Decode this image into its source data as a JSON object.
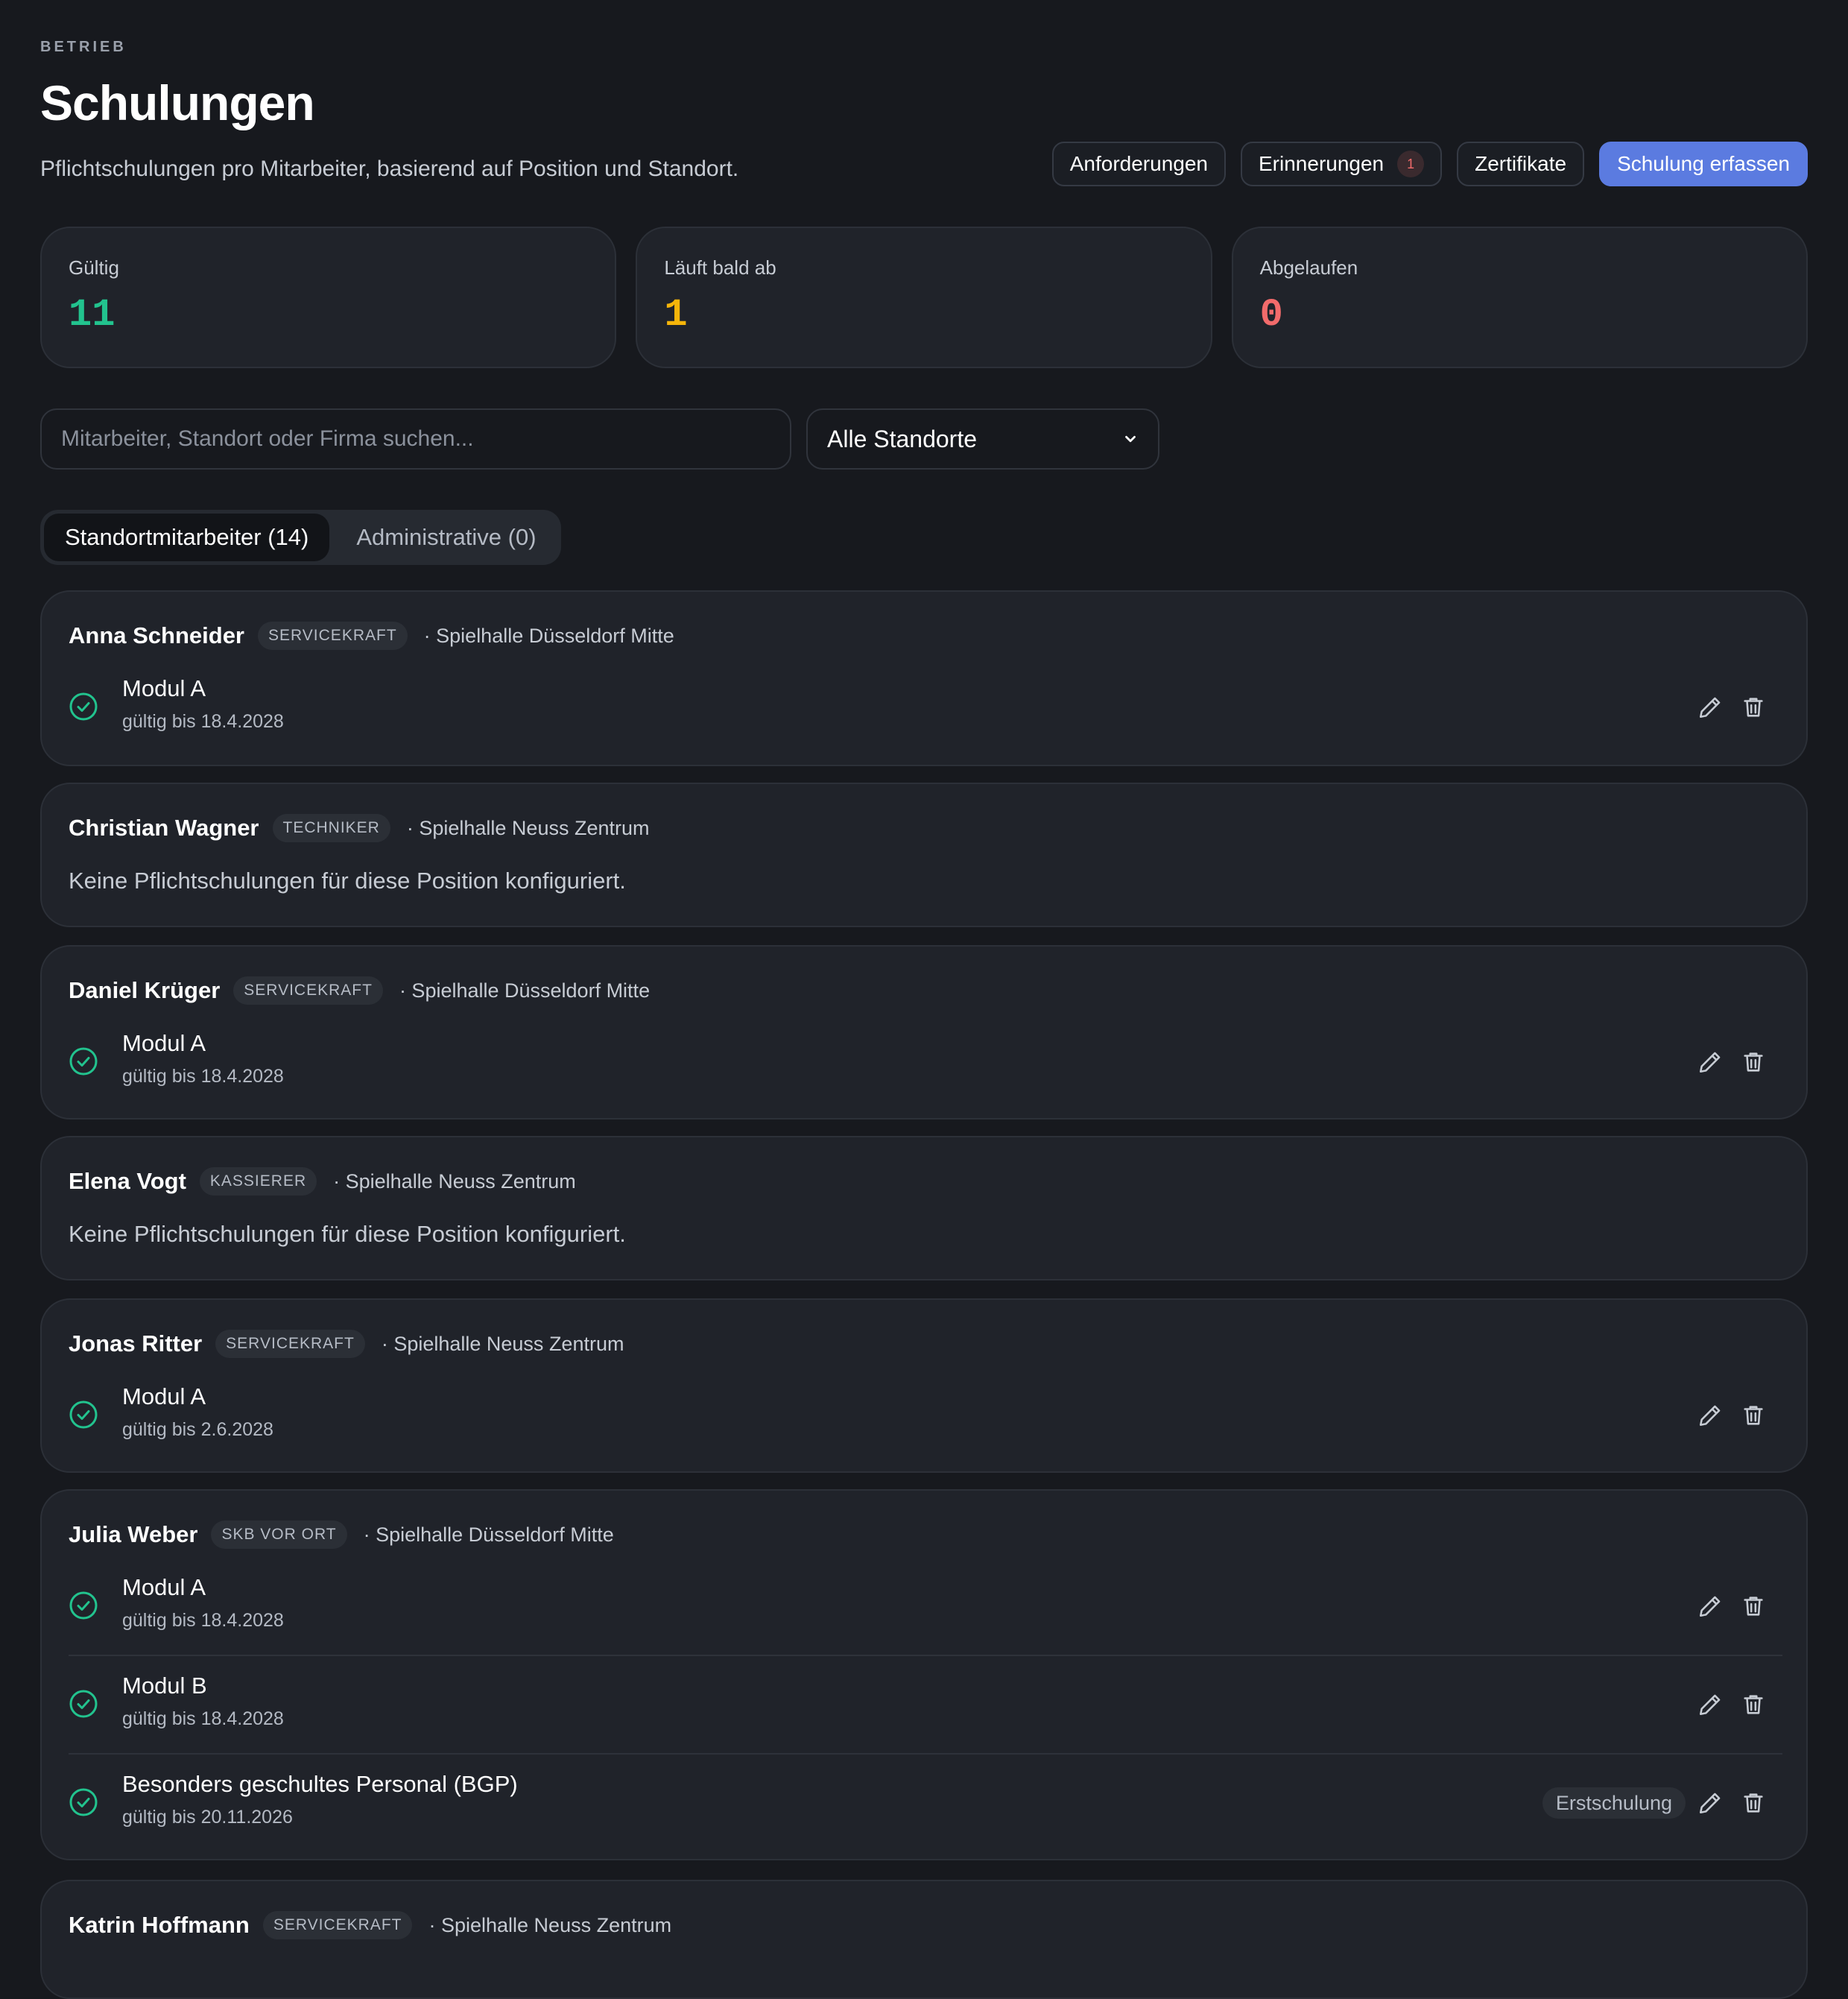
{
  "header": {
    "eyebrow": "BETRIEB",
    "title": "Schulungen",
    "subtitle": "Pflichtschulungen pro Mitarbeiter, basierend auf Position und Standort."
  },
  "toolbar": {
    "requirements": "Anforderungen",
    "reminders": "Erinnerungen",
    "reminders_count": "1",
    "certificates": "Zertifikate",
    "add_training": "Schulung erfassen"
  },
  "stats": [
    {
      "label": "Gültig",
      "value": "11",
      "color": "#22c38e"
    },
    {
      "label": "Läuft bald ab",
      "value": "1",
      "color": "#f5b50a"
    },
    {
      "label": "Abgelaufen",
      "value": "0",
      "color": "#f26b6b"
    }
  ],
  "filters": {
    "search_placeholder": "Mitarbeiter, Standort oder Firma suchen...",
    "location_selected": "Alle Standorte"
  },
  "tabs": [
    {
      "label": "Standortmitarbeiter (14)",
      "active": true
    },
    {
      "label": "Administrative (0)",
      "active": false
    }
  ],
  "empty_text": "Keine Pflichtschulungen für diese Position konfiguriert.",
  "employees": [
    {
      "name": "Anna Schneider",
      "role": "SERVICEKRAFT",
      "location": "· Spielhalle Düsseldorf Mitte",
      "trainings": [
        {
          "name": "Modul A",
          "valid": "gültig bis 18.4.2028"
        }
      ]
    },
    {
      "name": "Christian Wagner",
      "role": "TECHNIKER",
      "location": "· Spielhalle Neuss Zentrum",
      "trainings": []
    },
    {
      "name": "Daniel Krüger",
      "role": "SERVICEKRAFT",
      "location": "· Spielhalle Düsseldorf Mitte",
      "trainings": [
        {
          "name": "Modul A",
          "valid": "gültig bis 18.4.2028"
        }
      ]
    },
    {
      "name": "Elena Vogt",
      "role": "KASSIERER",
      "location": "· Spielhalle Neuss Zentrum",
      "trainings": []
    },
    {
      "name": "Jonas Ritter",
      "role": "SERVICEKRAFT",
      "location": "· Spielhalle Neuss Zentrum",
      "trainings": [
        {
          "name": "Modul A",
          "valid": "gültig bis 2.6.2028"
        }
      ]
    },
    {
      "name": "Julia Weber",
      "role": "SKB VOR ORT",
      "location": "· Spielhalle Düsseldorf Mitte",
      "trainings": [
        {
          "name": "Modul A",
          "valid": "gültig bis 18.4.2028"
        },
        {
          "name": "Modul B",
          "valid": "gültig bis 18.4.2028"
        },
        {
          "name": "Besonders geschultes Personal (BGP)",
          "valid": "gültig bis 20.11.2026",
          "tag": "Erstschulung"
        }
      ]
    },
    {
      "name": "Katrin Hoffmann",
      "role": "SERVICEKRAFT",
      "location": "· Spielhalle Neuss Zentrum",
      "trainings": []
    }
  ],
  "icons": {
    "status": "check-circle-icon",
    "edit": "pencil-icon",
    "delete": "trash-icon",
    "dropdown": "chevron-down-icon"
  },
  "colors": {
    "background": "#17191e",
    "card": "#20232a",
    "primary": "#5b7be0",
    "valid": "#22c38e"
  }
}
